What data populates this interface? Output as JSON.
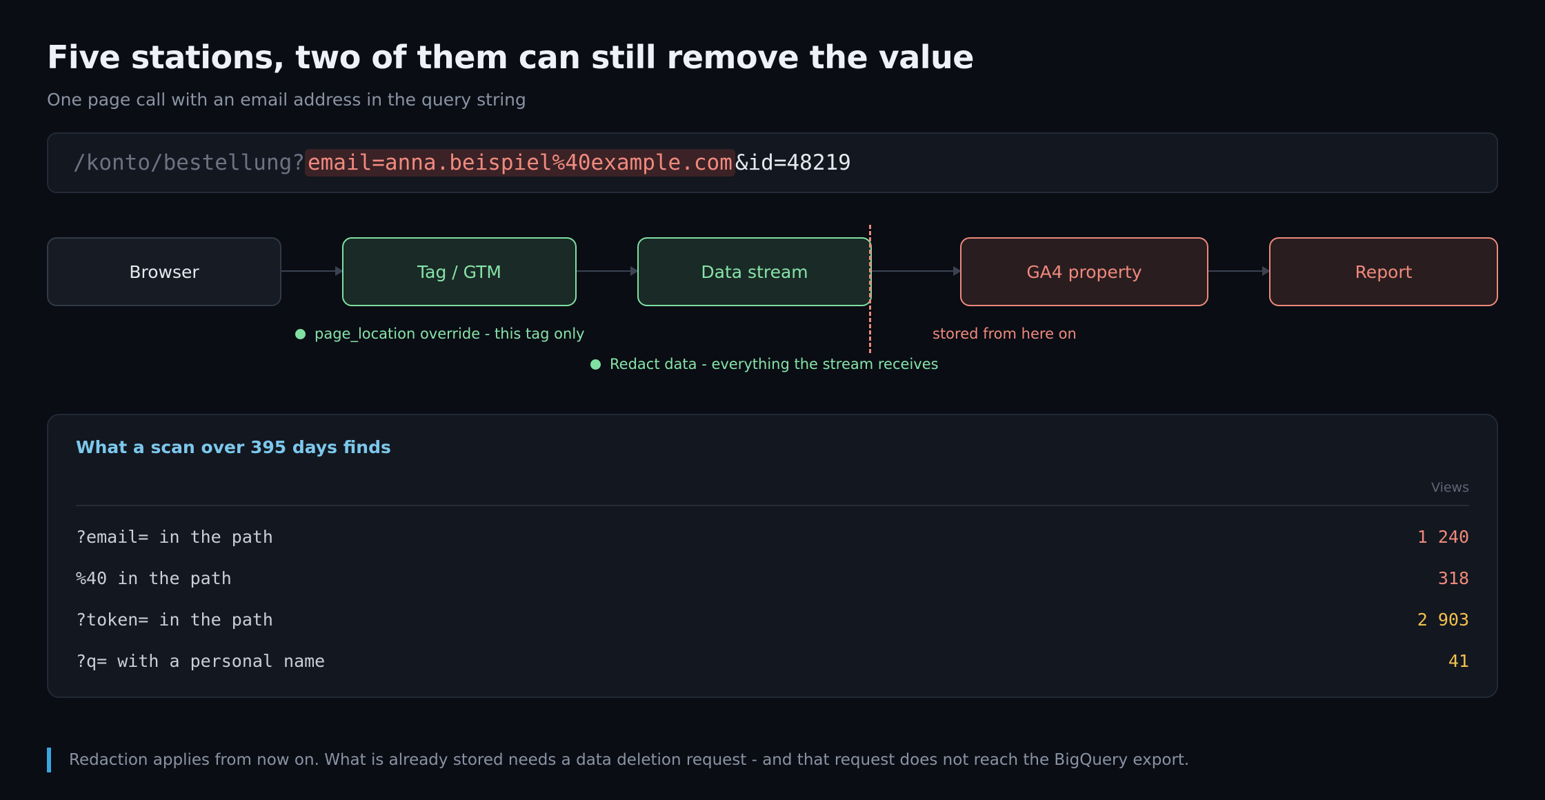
{
  "header": {
    "title": "Five stations, two of them can still remove the value",
    "subtitle": "One page call with an email address in the query string"
  },
  "url": {
    "path": "/konto/bestellung?",
    "pii": "email=anna.beispiel%40example.com",
    "rest": "&id=48219"
  },
  "flow": {
    "stations": [
      {
        "label": "Browser",
        "state": "neutral"
      },
      {
        "label": "Tag / GTM",
        "state": "can-remove"
      },
      {
        "label": "Data stream",
        "state": "can-remove"
      },
      {
        "label": "GA4 property",
        "state": "stored"
      },
      {
        "label": "Report",
        "state": "stored"
      }
    ],
    "notes": {
      "tag": "page_location override - this tag only",
      "stream": "Redact data - everything the stream receives",
      "stored": "stored from here on"
    }
  },
  "scan": {
    "title": "What a scan over 395 days finds",
    "column": "Views",
    "rows": [
      {
        "label": "?email= in the path",
        "value": "1 240",
        "severity": "red"
      },
      {
        "label": "%40 in the path",
        "value": "318",
        "severity": "red"
      },
      {
        "label": "?token= in the path",
        "value": "2 903",
        "severity": "amber"
      },
      {
        "label": "?q= with a personal name",
        "value": "41",
        "severity": "amber"
      }
    ]
  },
  "footer": {
    "note": "Redaction applies from now on. What is already stored needs a data deletion request - and that request does not reach the BigQuery export."
  },
  "colors": {
    "background": "#0a0d14",
    "green": "#7fe0a2",
    "red": "#ef8a7c",
    "amber": "#f2c14e",
    "blue": "#7cc8ec"
  }
}
